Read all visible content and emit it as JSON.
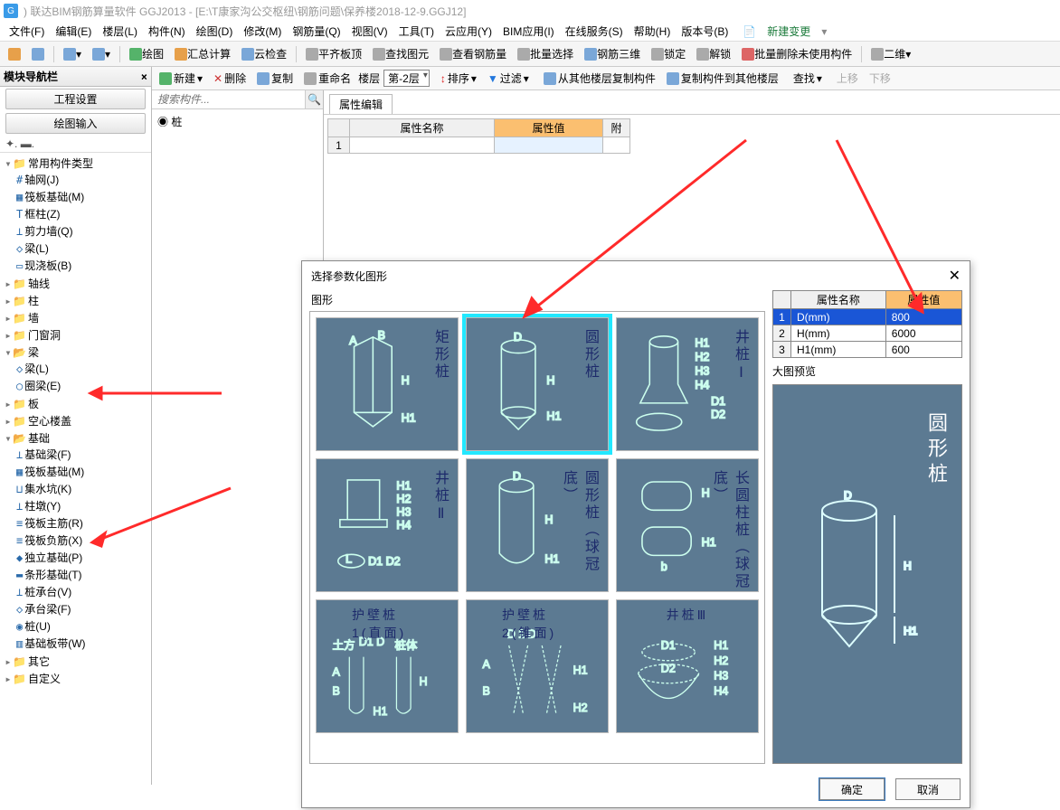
{
  "title": ")  联达BIM钢筋算量软件 GGJ2013 - [E:\\T康家沟公交枢纽\\钢筋问题\\保养楼2018-12-9.GGJ12]",
  "menu": [
    "文件(F)",
    "编辑(E)",
    "楼层(L)",
    "构件(N)",
    "绘图(D)",
    "修改(M)",
    "钢筋量(Q)",
    "视图(V)",
    "工具(T)",
    "云应用(Y)",
    "BIM应用(I)",
    "在线服务(S)",
    "帮助(H)",
    "版本号(B)"
  ],
  "menu_newchange": "新建变更",
  "toolbar1": {
    "draw": "绘图",
    "summary": "汇总计算",
    "cloud": "云检查",
    "flat": "平齐板顶",
    "viewel": "查找图元",
    "viewbar": "查看钢筋量",
    "batchsel": "批量选择",
    "rebar3d": "钢筋三维",
    "lock": "锁定",
    "unlock": "解锁",
    "batchdel": "批量删除未使用构件",
    "dim": "二维"
  },
  "toolbar2": {
    "new": "新建",
    "del": "删除",
    "copy": "复制",
    "rename": "重命名",
    "floor": "楼层",
    "floor_val": "第-2层",
    "sort": "排序",
    "filter": "过滤",
    "copyfromfloor": "从其他楼层复制构件",
    "copytofloor": "复制构件到其他楼层",
    "find": "查找",
    "up": "上移",
    "down": "下移"
  },
  "left": {
    "navbar": "模块导航栏",
    "proj": "工程设置",
    "drawin": "绘图输入"
  },
  "search_placeholder": "搜索构件...",
  "tree": {
    "root": "常用构件类型",
    "c1": "轴网(J)",
    "c2": "筏板基础(M)",
    "c3": "框柱(Z)",
    "c4": "剪力墙(Q)",
    "c5": "梁(L)",
    "c6": "现浇板(B)",
    "n1": "轴线",
    "n2": "柱",
    "n3": "墙",
    "n4": "门窗洞",
    "n5": "梁",
    "n5a": "梁(L)",
    "n5b": "圈梁(E)",
    "n6": "板",
    "n7": "空心楼盖",
    "n8": "基础",
    "b1": "基础梁(F)",
    "b2": "筏板基础(M)",
    "b3": "集水坑(K)",
    "b4": "柱墩(Y)",
    "b5": "筏板主筋(R)",
    "b6": "筏板负筋(X)",
    "b7": "独立基础(P)",
    "b8": "条形基础(T)",
    "b9": "桩承台(V)",
    "b10": "承台梁(F)",
    "b11": "桩(U)",
    "b12": "基础板带(W)",
    "n9": "其它",
    "n10": "自定义"
  },
  "mid_item": "桩",
  "proptab": "属性编辑",
  "prop_headers": {
    "name": "属性名称",
    "val": "属性值",
    "ext": "附"
  },
  "dialog": {
    "title": "选择参数化图形",
    "grp": "图形",
    "thumbs": [
      "矩形桩",
      "圆形桩",
      "井桩Ⅰ",
      "井桩Ⅱ",
      "圆形桩（球冠底）",
      "长圆柱桩（球冠底）",
      "护壁桩1(直面)",
      "护壁桩2(锥面)",
      "井桩Ⅲ"
    ],
    "param_headers": {
      "name": "属性名称",
      "val": "属性值"
    },
    "params": [
      {
        "n": "D(mm)",
        "v": "800"
      },
      {
        "n": "H(mm)",
        "v": "6000"
      },
      {
        "n": "H1(mm)",
        "v": "600"
      }
    ],
    "preview_label": "大图预览",
    "preview_cap": "圆形桩",
    "ok": "确定",
    "cancel": "取消"
  }
}
